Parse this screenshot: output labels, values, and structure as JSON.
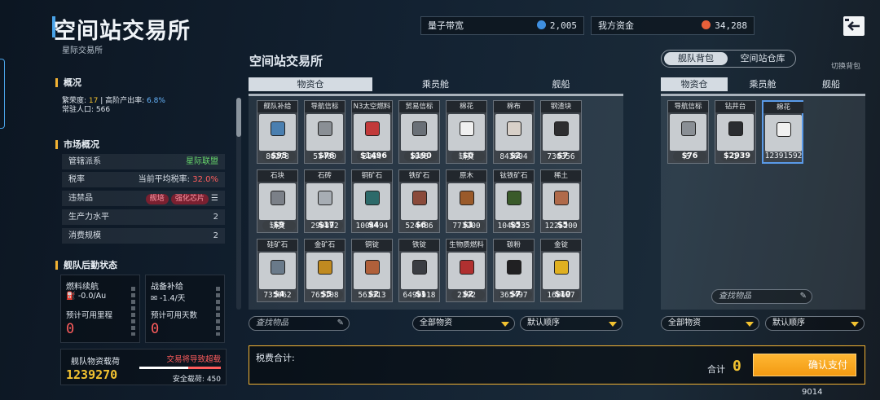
{
  "header": {
    "title": "空间站交易所",
    "subtitle": "星际交易所"
  },
  "topbar": {
    "bandwidth_label": "量子带宽",
    "bandwidth_value": "2,005",
    "funds_label": "我方资金",
    "funds_value": "34,288"
  },
  "overview": {
    "head": "概况",
    "prosperity_label": "繁荣度: ",
    "prosperity": "17",
    "sep": " | ",
    "output_label": "高阶产出率: ",
    "output": "6.8%",
    "pop_label": "常驻人口: ",
    "pop": "566"
  },
  "market": {
    "head": "市场概况",
    "rows": [
      {
        "label": "管辖派系",
        "value": "星际联盟"
      },
      {
        "label": "税率",
        "value_label": "当前平均税率: ",
        "value": "32.0%"
      },
      {
        "label": "违禁品",
        "tags": [
          "舰培",
          "强化芯片"
        ]
      },
      {
        "label": "生产力水平",
        "value": "2"
      },
      {
        "label": "消费规模",
        "value": "2"
      }
    ]
  },
  "logistics": {
    "head": "舰队后勤状态",
    "fuel_label": "燃料续航",
    "fuel_rate": "-0.0/Au",
    "range_label": "预计可用里程",
    "range_value": "0",
    "supply_label": "战备补给",
    "supply_rate": "-1.4/天",
    "days_label": "预计可用天数",
    "days_value": "0",
    "cargo_label": "舰队物资载荷",
    "cargo_value": "1239270",
    "warn": "交易将导致超载",
    "safe_label": "安全载荷: ",
    "safe_value": "450"
  },
  "market_panel": {
    "title": "空间站交易所",
    "tabs": [
      "物资仓",
      "乘员舱",
      "舰船"
    ],
    "search_placeholder": "查找物品",
    "filter": "全部物资",
    "sort": "默认顺序"
  },
  "items": [
    {
      "name": "舰队补给",
      "price": "$95",
      "qty": "80278",
      "icon": "supply-crate",
      "color": "#4a7fb0"
    },
    {
      "name": "导航信标",
      "price": "$76",
      "qty": "57409",
      "icon": "beacon",
      "color": "#8a8f95"
    },
    {
      "name": "N3太空燃料",
      "price": "$1496",
      "qty": "3864",
      "icon": "fuel-canister",
      "color": "#c23a3a"
    },
    {
      "name": "贸易信标",
      "price": "$190",
      "qty": "1808",
      "icon": "trade-beacon",
      "color": "#6a7077"
    },
    {
      "name": "棉花",
      "price": "$0",
      "qty": "缺货",
      "icon": "cotton",
      "color": "#f0f0f0"
    },
    {
      "name": "棉布",
      "price": "$2",
      "qty": "843894",
      "icon": "cloth-roll",
      "color": "#d8d0c8"
    },
    {
      "name": "钢渣块",
      "price": "$7",
      "qty": "730356",
      "icon": "slag",
      "color": "#2e2e30"
    },
    {
      "name": "石块",
      "price": "$9",
      "qty": "缺货",
      "icon": "stone",
      "color": "#7b8088"
    },
    {
      "name": "石砖",
      "price": "$17",
      "qty": "299892",
      "icon": "brick",
      "color": "#a7adb4"
    },
    {
      "name": "铜矿石",
      "price": "$4",
      "qty": "1004494",
      "icon": "copper-ore",
      "color": "#2d6a6a"
    },
    {
      "name": "铁矿石",
      "price": "$6",
      "qty": "524486",
      "icon": "iron-ore",
      "color": "#8a4a3a"
    },
    {
      "name": "原木",
      "price": "$1",
      "qty": "773200",
      "icon": "log",
      "color": "#9a5a2a"
    },
    {
      "name": "钛铁矿石",
      "price": "$5",
      "qty": "1040235",
      "icon": "titanium-ore",
      "color": "#3a5a2a"
    },
    {
      "name": "稀土",
      "price": "$5",
      "qty": "1225200",
      "icon": "rare-earth",
      "color": "#b06a4a"
    },
    {
      "name": "硅矿石",
      "price": "$4",
      "qty": "735062",
      "icon": "silicon-ore",
      "color": "#6a7a8a"
    },
    {
      "name": "金矿石",
      "price": "$5",
      "qty": "765108",
      "icon": "gold-ore",
      "color": "#c08a20"
    },
    {
      "name": "铜锭",
      "price": "$2",
      "qty": "563313",
      "icon": "copper-ingot",
      "color": "#b0603a"
    },
    {
      "name": "铁锭",
      "price": "$1",
      "qty": "6499918",
      "icon": "iron-ingot",
      "color": "#3a3d42"
    },
    {
      "name": "生物质燃料",
      "price": "$2",
      "qty": "2392",
      "icon": "biofuel",
      "color": "#b03030"
    },
    {
      "name": "碳粉",
      "price": "$7",
      "qty": "365497",
      "icon": "carbon-powder",
      "color": "#202022"
    },
    {
      "name": "金锭",
      "price": "$10",
      "qty": "169687",
      "icon": "gold-ingot",
      "color": "#e0b020"
    }
  ],
  "backpack": {
    "toggle": [
      "舰队背包",
      "空间站仓库"
    ],
    "switch_label": "切换背包",
    "tabs": [
      "物资仓",
      "乘员舱",
      "舰船"
    ],
    "items": [
      {
        "name": "导航信标",
        "price": "$76",
        "qty": "5",
        "icon": "beacon",
        "color": "#8a8f95"
      },
      {
        "name": "钻井台",
        "price": "$2939",
        "qty": "1",
        "icon": "drill-rig",
        "color": "#2a2c30"
      },
      {
        "name": "棉花",
        "price": "",
        "qty": "12391592",
        "icon": "cotton",
        "color": "#f0f0f0"
      }
    ],
    "search_placeholder": "查找物品",
    "filter": "全部物资",
    "sort": "默认顺序"
  },
  "footer": {
    "tax_label": "税费合计:",
    "total_label": "合计",
    "total_value": "0",
    "confirm": "确认支付",
    "counter": "9014"
  }
}
